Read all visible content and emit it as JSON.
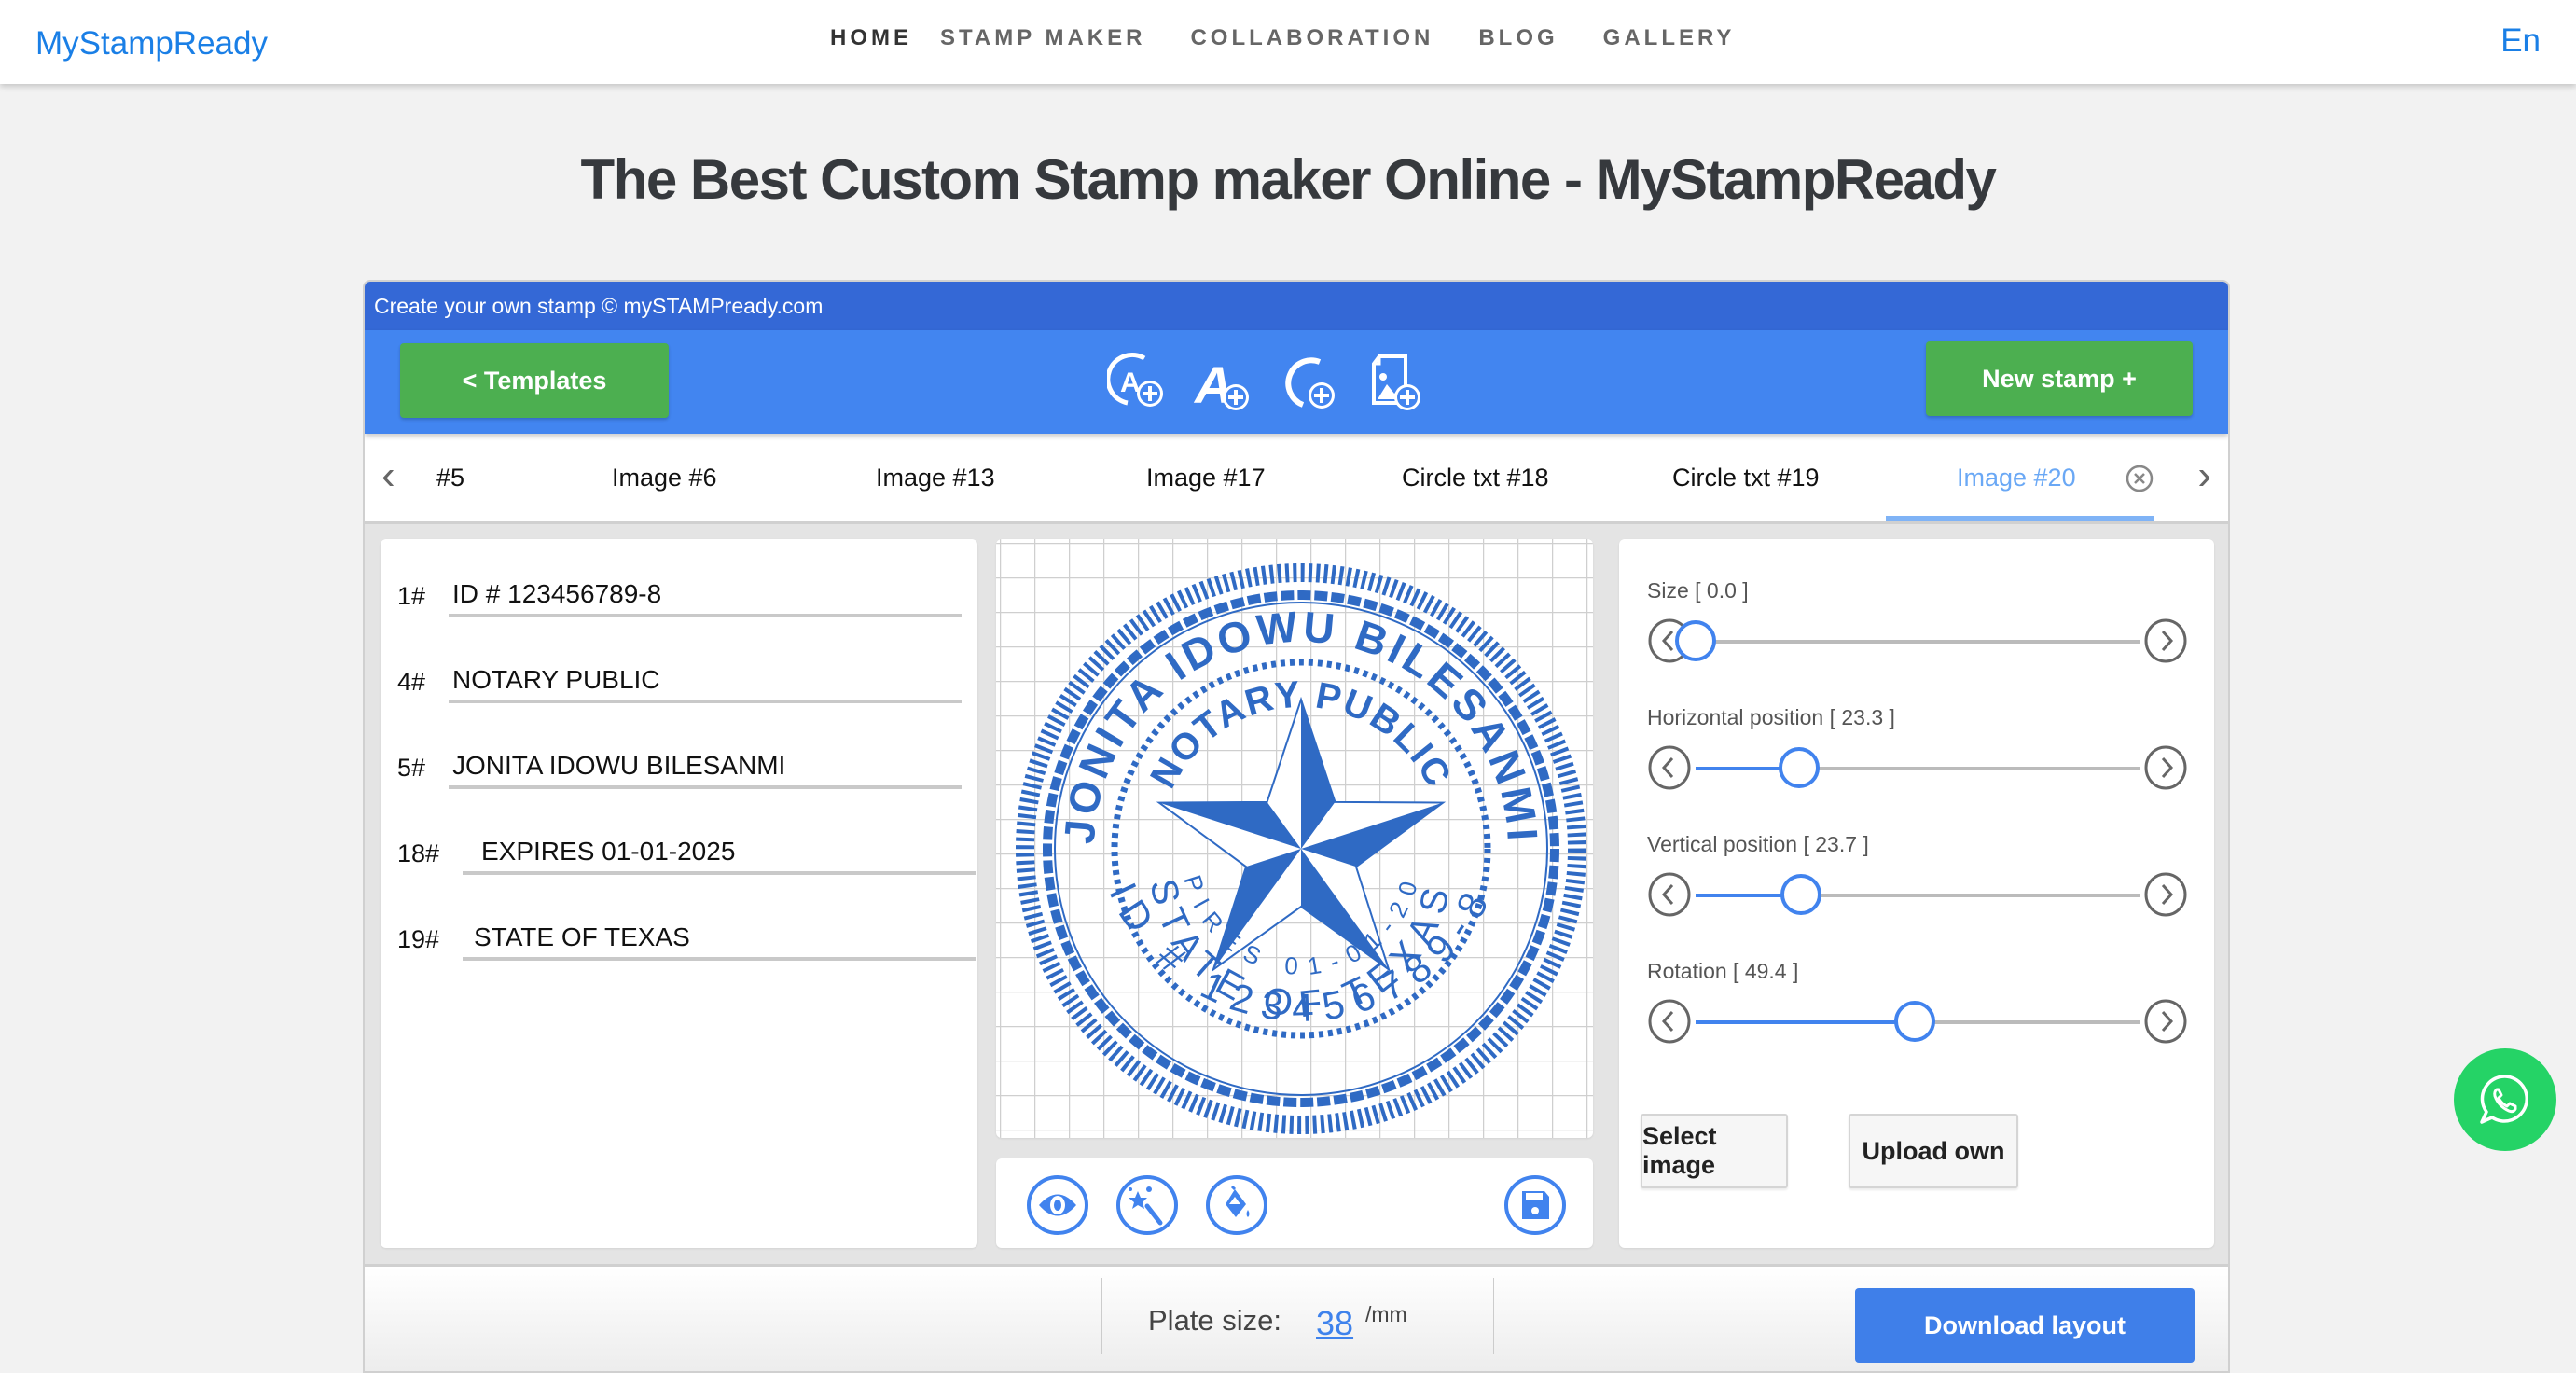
{
  "nav": {
    "brand": "MyStampReady",
    "links": [
      "HOME",
      "STAMP MAKER",
      "COLLABORATION",
      "BLOG",
      "GALLERY"
    ],
    "language": "En"
  },
  "page_title": "The Best Custom Stamp maker Online - MyStampReady",
  "editor": {
    "header": "Create your own stamp © mySTAMPready.com",
    "templates_button": "<  Templates",
    "new_stamp_button": "New stamp +",
    "toolbar_icons": [
      "add-circle-text-icon",
      "add-text-icon",
      "add-circle-icon",
      "add-image-icon"
    ],
    "tabs": [
      "#5",
      "Image #6",
      "Image #13",
      "Image #17",
      "Circle txt #18",
      "Circle txt #19",
      "Image #20"
    ],
    "active_tab": "Image #20",
    "fields": [
      {
        "num": "1#",
        "value": "ID # 123456789-8"
      },
      {
        "num": "4#",
        "value": "NOTARY PUBLIC"
      },
      {
        "num": "5#",
        "value": "JONITA IDOWU BILESANMI"
      },
      {
        "num": "18#",
        "value": "EXPIRES 01-01-2025"
      },
      {
        "num": "19#",
        "value": "STATE OF TEXAS"
      }
    ],
    "stamp": {
      "color": "#2f6ac4",
      "outer_text": "JONITA IDOWU BILESANMI",
      "inner_top_text": "NOTARY PUBLIC",
      "bottom_text": "ID # 123456789-8",
      "inner_bottom_text": "STATE OF TEXAS",
      "innermost_text": "EXPIRES 01-01-2025"
    },
    "canvas_tools": [
      "eye-icon",
      "magic-wand-icon",
      "paint-bucket-icon",
      "save-icon"
    ],
    "sliders": [
      {
        "label": "Size [ 0.0 ]",
        "fraction": 0.0
      },
      {
        "label": "Horizontal position [ 23.3 ]",
        "fraction": 0.233
      },
      {
        "label": "Vertical position [ 23.7 ]",
        "fraction": 0.237
      },
      {
        "label": "Rotation [ 49.4 ]",
        "fraction": 0.494
      }
    ],
    "select_image": "Select image",
    "upload_own": "Upload own",
    "plate_size_label": "Plate size:",
    "plate_size_value": "38",
    "plate_size_unit": "/mm",
    "download_button": "Download layout"
  },
  "colors": {
    "brand_blue": "#1a7fe6",
    "header_blue": "#3468d6",
    "toolbar_blue": "#4285f0",
    "green": "#4caf50",
    "accent": "#4183ee",
    "whatsapp": "#25d366"
  }
}
